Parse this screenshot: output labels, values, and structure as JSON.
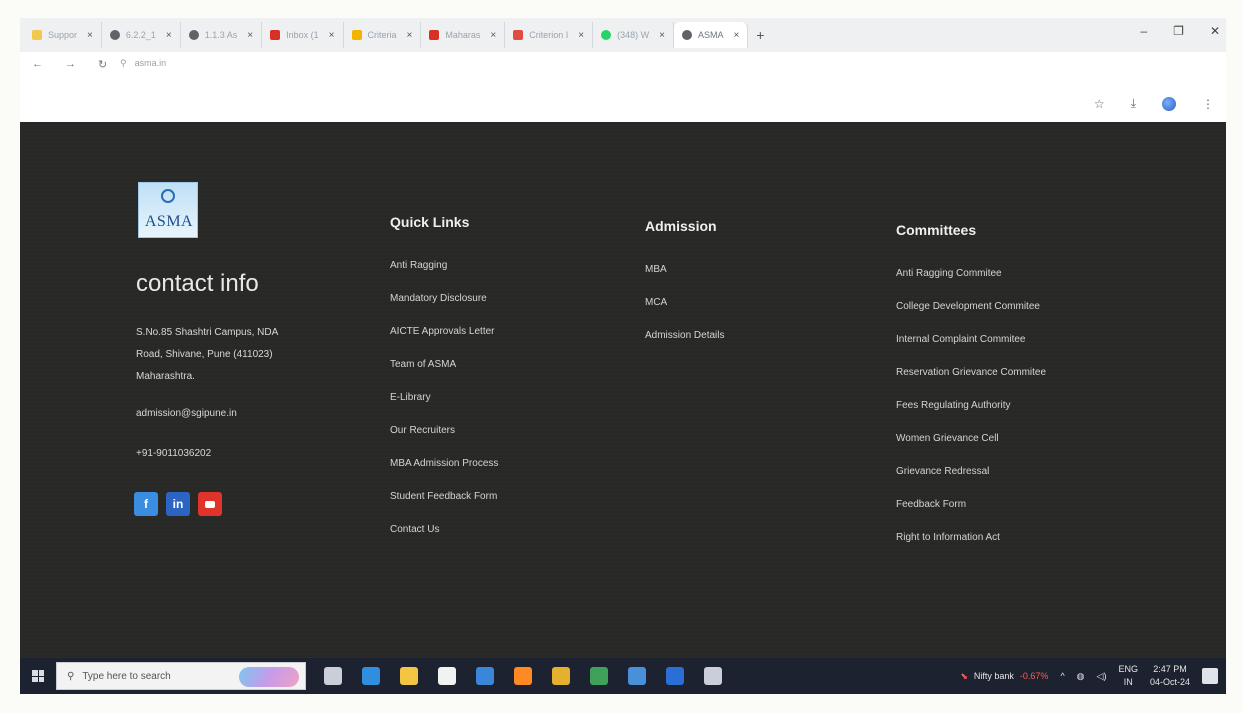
{
  "browser": {
    "tabs": [
      {
        "label": "Suppor",
        "color": "#f2c94c"
      },
      {
        "label": "6.2.2_1",
        "color": "#5f6368"
      },
      {
        "label": "1.1.3 As",
        "color": "#5f6368"
      },
      {
        "label": "Inbox (1",
        "color": "#d93025"
      },
      {
        "label": "Criteria",
        "color": "#f2b400"
      },
      {
        "label": "Maharas",
        "color": "#d93025"
      },
      {
        "label": "Criterion I",
        "color": "#e24c3f"
      },
      {
        "label": "(348) W",
        "color": "#25d366"
      },
      {
        "label": "ASMA",
        "color": "#5f6368"
      }
    ],
    "new_tab": "+",
    "url": "asma.in",
    "back": "←",
    "forward": "→",
    "reload": "↻",
    "minimize": "–",
    "restore": "❐",
    "close": "✕",
    "bookmark_icon": "☆",
    "download_icon": "⤓",
    "menu_icon": "⋮"
  },
  "footer": {
    "logo_text": "ASMA",
    "contact_title": "contact info",
    "address_lines": [
      "S.No.85 Shashtri Campus, NDA",
      "Road, Shivane, Pune (411023)",
      "Maharashtra."
    ],
    "email": "admission@sgipune.in",
    "phone": "+91-9011036202",
    "social": {
      "facebook": "f",
      "linkedin": "in"
    },
    "quick_links": {
      "title": "Quick Links",
      "items": [
        "Anti Ragging",
        "Mandatory Disclosure",
        "AICTE Approvals Letter",
        "Team of ASMA",
        "E-Library",
        "Our Recruiters",
        "MBA Admission Process",
        "Student Feedback Form",
        "Contact Us"
      ]
    },
    "admission": {
      "title": "Admission",
      "items": [
        "MBA",
        "MCA",
        "Admission Details"
      ]
    },
    "committees": {
      "title": "Committees",
      "items": [
        "Anti Ragging Commitee",
        "College Development Commitee",
        "Internal Complaint Commitee",
        "Reservation Grievance Commitee",
        "Fees Regulating Authority",
        "Women Grievance Cell",
        "Grievance Redressal",
        "Feedback Form",
        "Right to Information Act"
      ]
    }
  },
  "taskbar": {
    "search_placeholder": "Type here to search",
    "nifty_label": "Nifty bank",
    "nifty_change": "-0.67%",
    "lang_top": "ENG",
    "lang_bottom": "IN",
    "time": "2:47 PM",
    "date": "04-Oct-24",
    "icons": [
      {
        "name": "task-view-icon",
        "color": "#c9ced8"
      },
      {
        "name": "edge-icon",
        "color": "#2f8fde"
      },
      {
        "name": "file-explorer-icon",
        "color": "#f4c542"
      },
      {
        "name": "store-icon",
        "color": "#f2f2f2"
      },
      {
        "name": "mail-icon",
        "color": "#3a86d8"
      },
      {
        "name": "firefox-icon",
        "color": "#ff8a24"
      },
      {
        "name": "chrome-icon",
        "color": "#e4b02e"
      },
      {
        "name": "chrome-active-icon",
        "color": "#3fa15a"
      },
      {
        "name": "app-icon",
        "color": "#4a90d9"
      },
      {
        "name": "word-icon",
        "color": "#2b6fd6"
      },
      {
        "name": "magnifier-icon",
        "color": "#c9ced8"
      }
    ]
  }
}
